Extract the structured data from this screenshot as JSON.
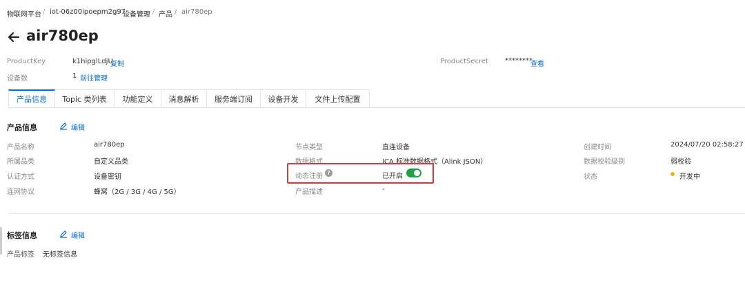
{
  "breadcrumb": [
    "物联网平台",
    "iot-06z00ipoepm2g97",
    "设备管理",
    "产品",
    "air780ep"
  ],
  "breadcrumb_sep": "/",
  "title": "air780ep",
  "product_key": {
    "label": "ProductKey",
    "value": "k1hipglLdjU",
    "action": "复制"
  },
  "product_secret": {
    "label": "ProductSecret",
    "value": "********",
    "action": "查看"
  },
  "device_count": {
    "label": "设备数",
    "value": "1",
    "action": "前往管理"
  },
  "tabs": [
    "产品信息",
    "Topic 类列表",
    "功能定义",
    "消息解析",
    "服务端订阅",
    "设备开发",
    "文件上传配置"
  ],
  "product_info": {
    "title": "产品信息",
    "edit": "编辑",
    "fields": {
      "name": {
        "label": "产品名称",
        "value": "air780ep"
      },
      "category": {
        "label": "所属品类",
        "value": "自定义品类"
      },
      "auth": {
        "label": "认证方式",
        "value": "设备密钥"
      },
      "network": {
        "label": "连网协议",
        "value": "蜂窝（2G / 3G / 4G / 5G）"
      },
      "node_type": {
        "label": "节点类型",
        "value": "直连设备"
      },
      "data_format": {
        "label": "数据格式",
        "value": "ICA 标准数据格式（Alink JSON）"
      },
      "dynamic_reg": {
        "label": "动态注册",
        "value": "已开启",
        "help": "?"
      },
      "description": {
        "label": "产品描述",
        "value": "-"
      },
      "created": {
        "label": "创建时间",
        "value": "2024/07/20 02:58:27"
      },
      "validation": {
        "label": "数据校验级别",
        "value": "弱校验"
      },
      "status": {
        "label": "状态",
        "value": "开发中"
      }
    }
  },
  "tag_info": {
    "title": "标签信息",
    "edit": "编辑",
    "label": "产品标签",
    "value": "无标签信息"
  },
  "colors": {
    "accent": "#0a6ed1",
    "toggle_on": "#23a047",
    "highlight": "#e0343b",
    "status_dev": "#f5b800"
  },
  "icons": {
    "back": "arrow-left-icon",
    "edit": "pencil-icon",
    "help": "question-circle-icon"
  }
}
